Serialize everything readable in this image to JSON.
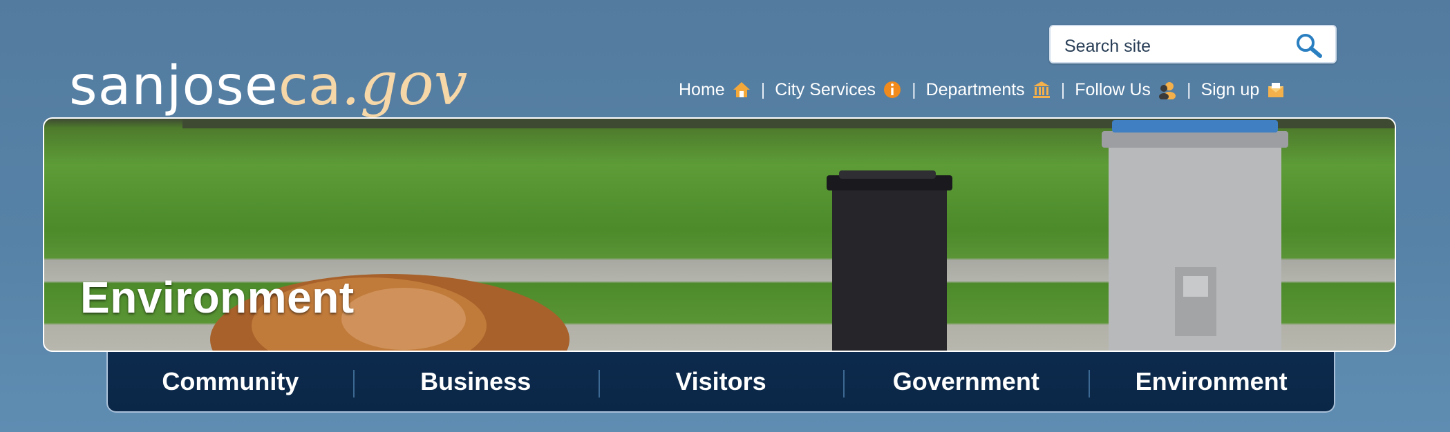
{
  "logo": {
    "part1": "sanjose",
    "part2": "ca",
    "part3": ".gov"
  },
  "search": {
    "placeholder": "Search site"
  },
  "top_nav": [
    {
      "label": "Home",
      "icon": "house-icon"
    },
    {
      "label": "City Services",
      "icon": "info-icon"
    },
    {
      "label": "Departments",
      "icon": "building-icon"
    },
    {
      "label": "Follow Us",
      "icon": "people-icon"
    },
    {
      "label": "Sign up",
      "icon": "envelope-icon"
    }
  ],
  "top_nav_separator": "|",
  "banner": {
    "title": "Environment"
  },
  "main_nav": [
    "Community",
    "Business",
    "Visitors",
    "Government",
    "Environment"
  ],
  "colors": {
    "background": "#5782a7",
    "nav_bar": "#0c2a4d",
    "logo_accent": "#f6d7a8",
    "icon_orange": "#f0a030"
  }
}
